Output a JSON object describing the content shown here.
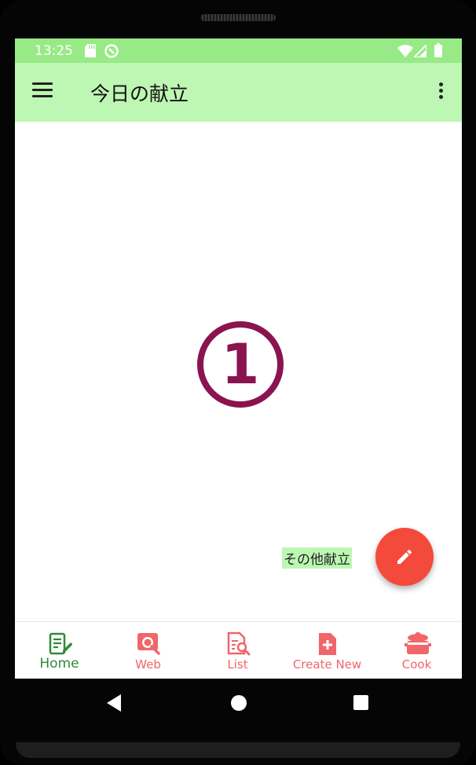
{
  "status_bar": {
    "time": "13:25",
    "icons": [
      "sd-card-icon",
      "sync-icon",
      "wifi-icon",
      "signal-icon",
      "battery-icon"
    ]
  },
  "app_bar": {
    "title": "今日の献立",
    "menu_icon": "hamburger-menu-icon",
    "overflow_icon": "more-vert-icon"
  },
  "content": {
    "step_number": "1",
    "chip_label": "その他献立",
    "fab_icon": "pencil-icon"
  },
  "bottom_nav": {
    "items": [
      {
        "label": "Home",
        "icon": "notebook-pencil-icon",
        "active": true
      },
      {
        "label": "Web",
        "icon": "web-search-icon",
        "active": false
      },
      {
        "label": "List",
        "icon": "list-search-icon",
        "active": false
      },
      {
        "label": "Create New",
        "icon": "file-add-icon",
        "active": false
      },
      {
        "label": "Cook",
        "icon": "pot-icon",
        "active": false
      }
    ]
  },
  "colors": {
    "status_bar": "#98ea86",
    "app_bar": "#bdf7b3",
    "step_number": "#8a1450",
    "fab": "#f44a3c",
    "nav_active": "#2f8a3a",
    "nav_inactive": "#f0666a"
  }
}
